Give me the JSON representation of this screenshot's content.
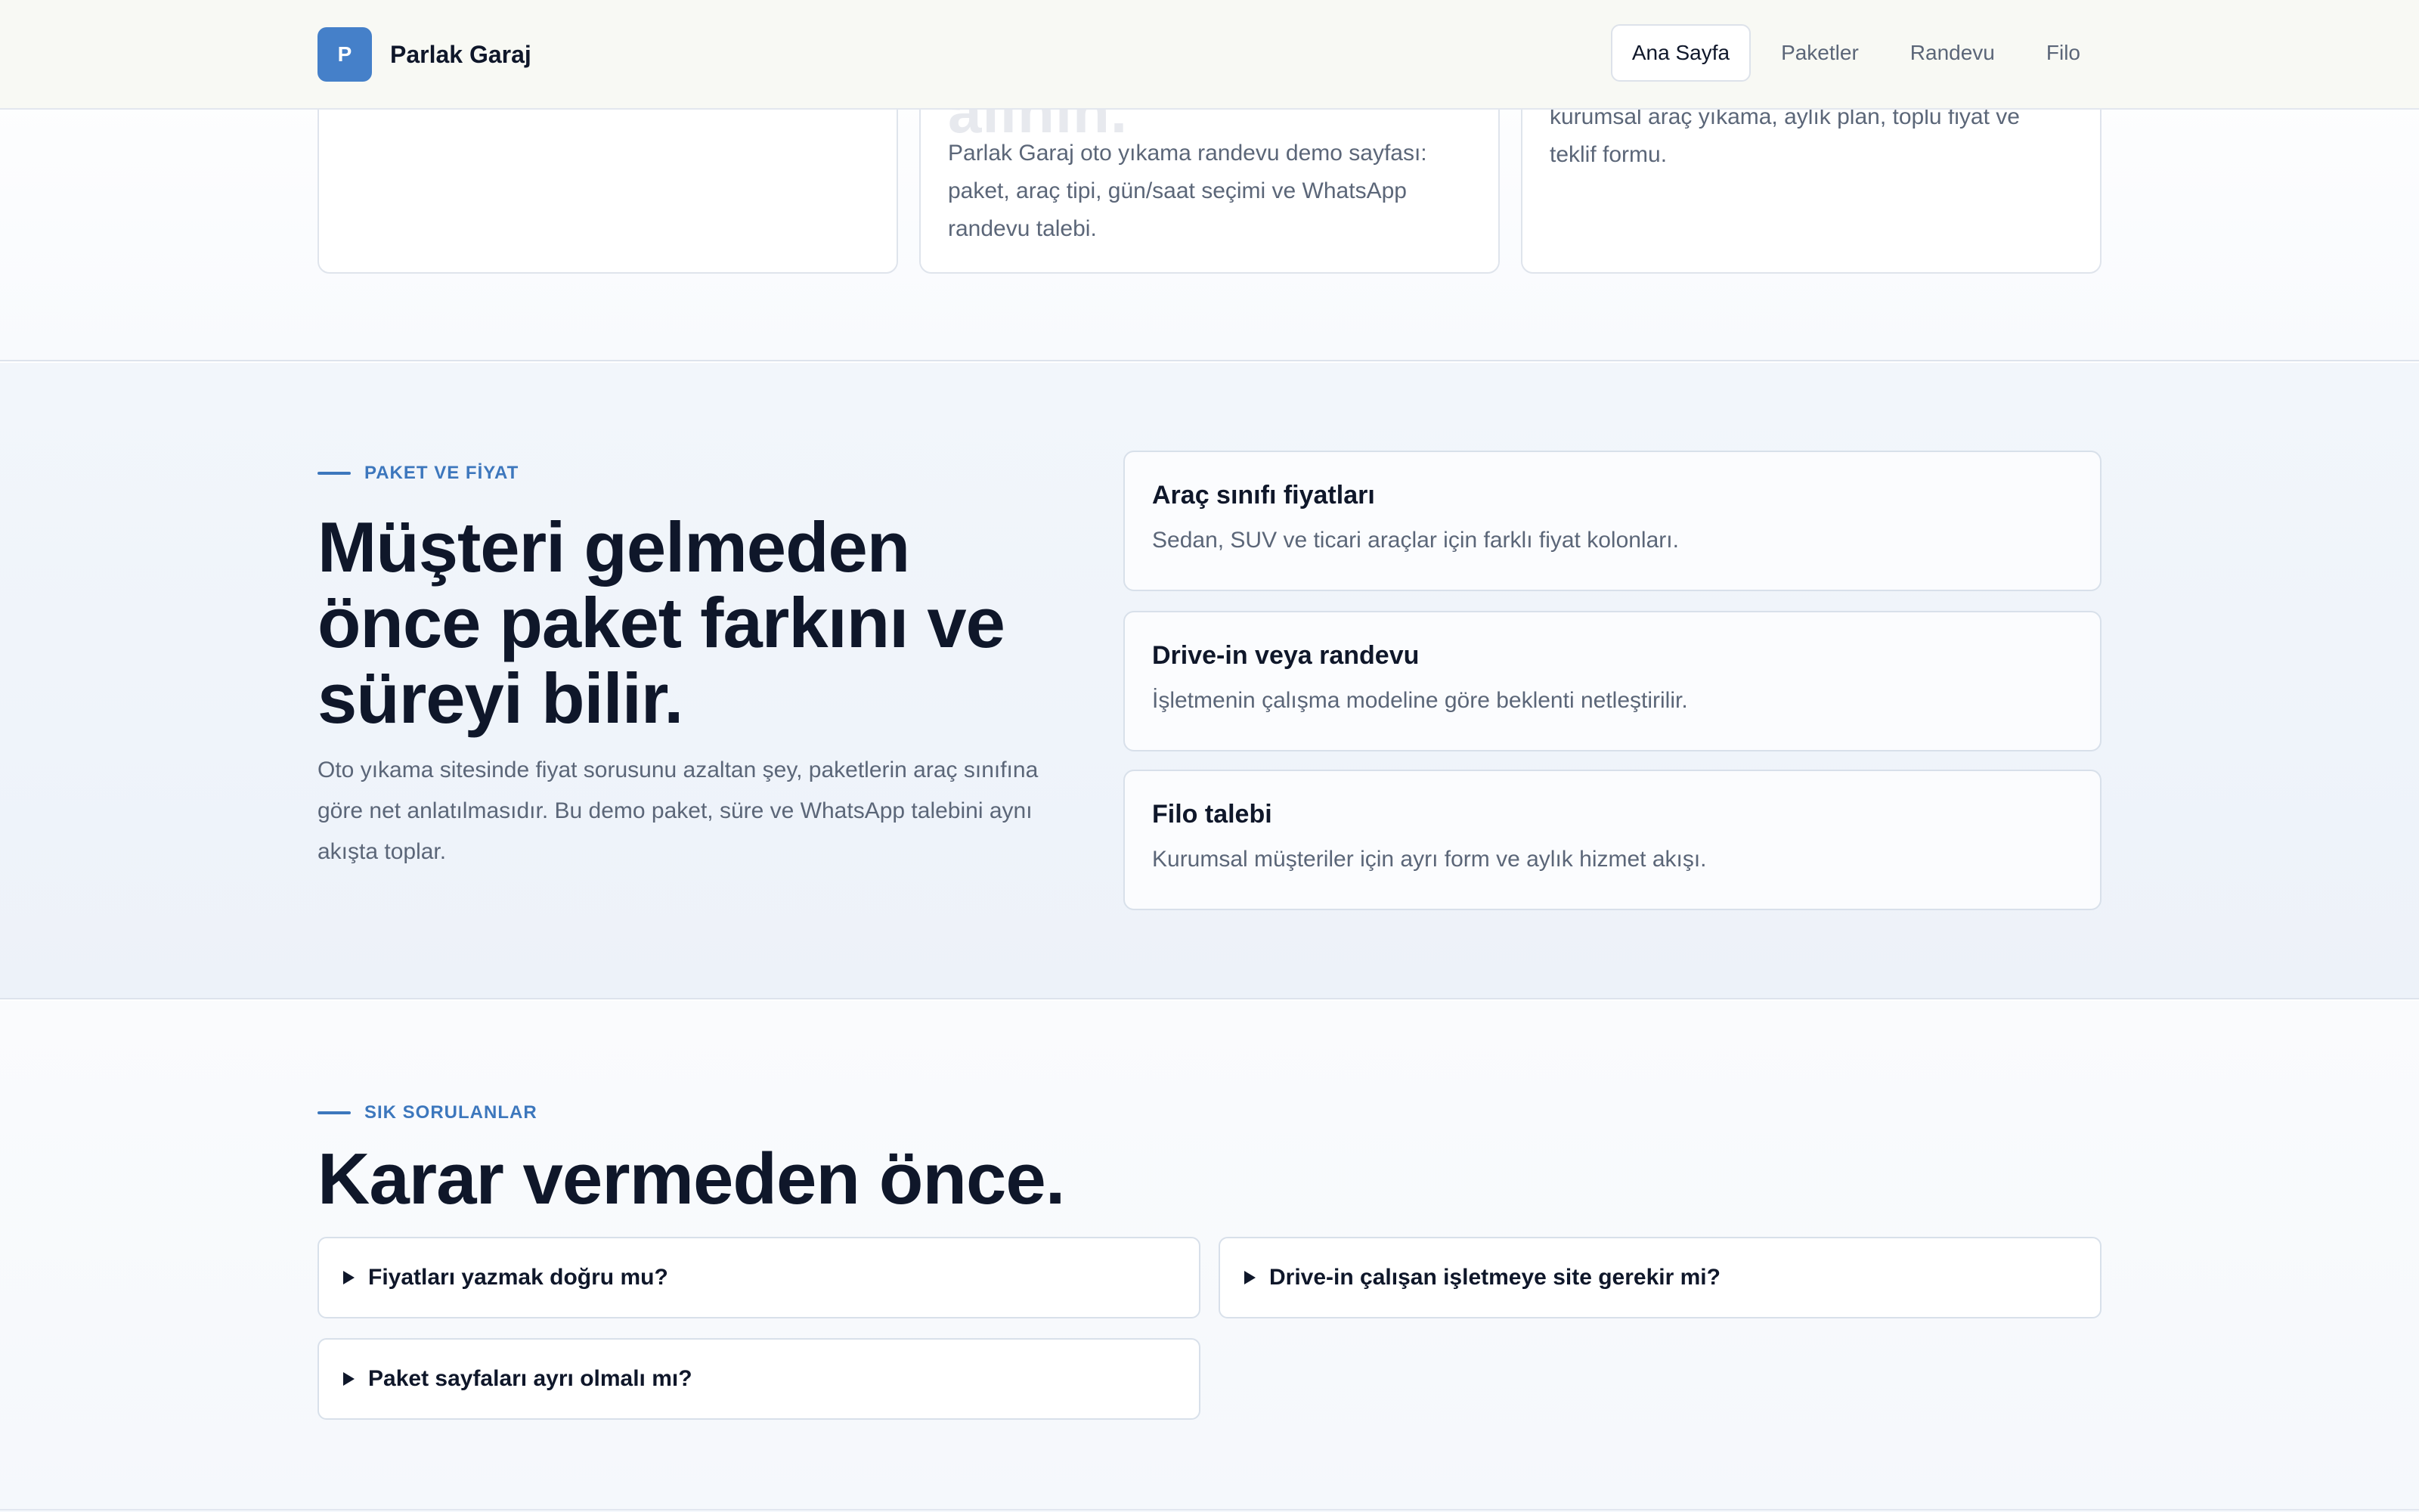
{
  "header": {
    "logo_letter": "P",
    "brand_name": "Parlak Garaj",
    "nav": [
      "Ana Sayfa",
      "Paketler",
      "Randevu",
      "Filo"
    ]
  },
  "top_cards": {
    "card2_ghost": "alının.",
    "card2_text": "Parlak Garaj oto yıkama randevu demo sayfası: paket, araç tipi, gün/saat seçimi ve WhatsApp randevu talebi.",
    "card3_text": "kurumsal araç yıkama, aylık plan, toplu fiyat ve teklif formu."
  },
  "pricing": {
    "eyebrow": "PAKET VE FİYAT",
    "title_line1": "Müşteri gelmeden",
    "title_line2": "önce paket farkını ve",
    "title_line3": "süreyi bilir.",
    "lead": "Oto yıkama sitesinde fiyat sorusunu azaltan şey, paketlerin araç sınıfına göre net anlatılmasıdır. Bu demo paket, süre ve WhatsApp talebini aynı akışta toplar.",
    "features": [
      {
        "title": "Araç sınıfı fiyatları",
        "text": "Sedan, SUV ve ticari araçlar için farklı fiyat kolonları."
      },
      {
        "title": "Drive-in veya randevu",
        "text": "İşletmenin çalışma modeline göre beklenti netleştirilir."
      },
      {
        "title": "Filo talebi",
        "text": "Kurumsal müşteriler için ayrı form ve aylık hizmet akışı."
      }
    ]
  },
  "faq": {
    "eyebrow": "SIK SORULANLAR",
    "title": "Karar vermeden önce.",
    "items": [
      "Fiyatları yazmak doğru mu?",
      "Drive-in çalışan işletmeye site gerekir mi?",
      "Paket sayfaları ayrı olmalı mı?"
    ]
  }
}
